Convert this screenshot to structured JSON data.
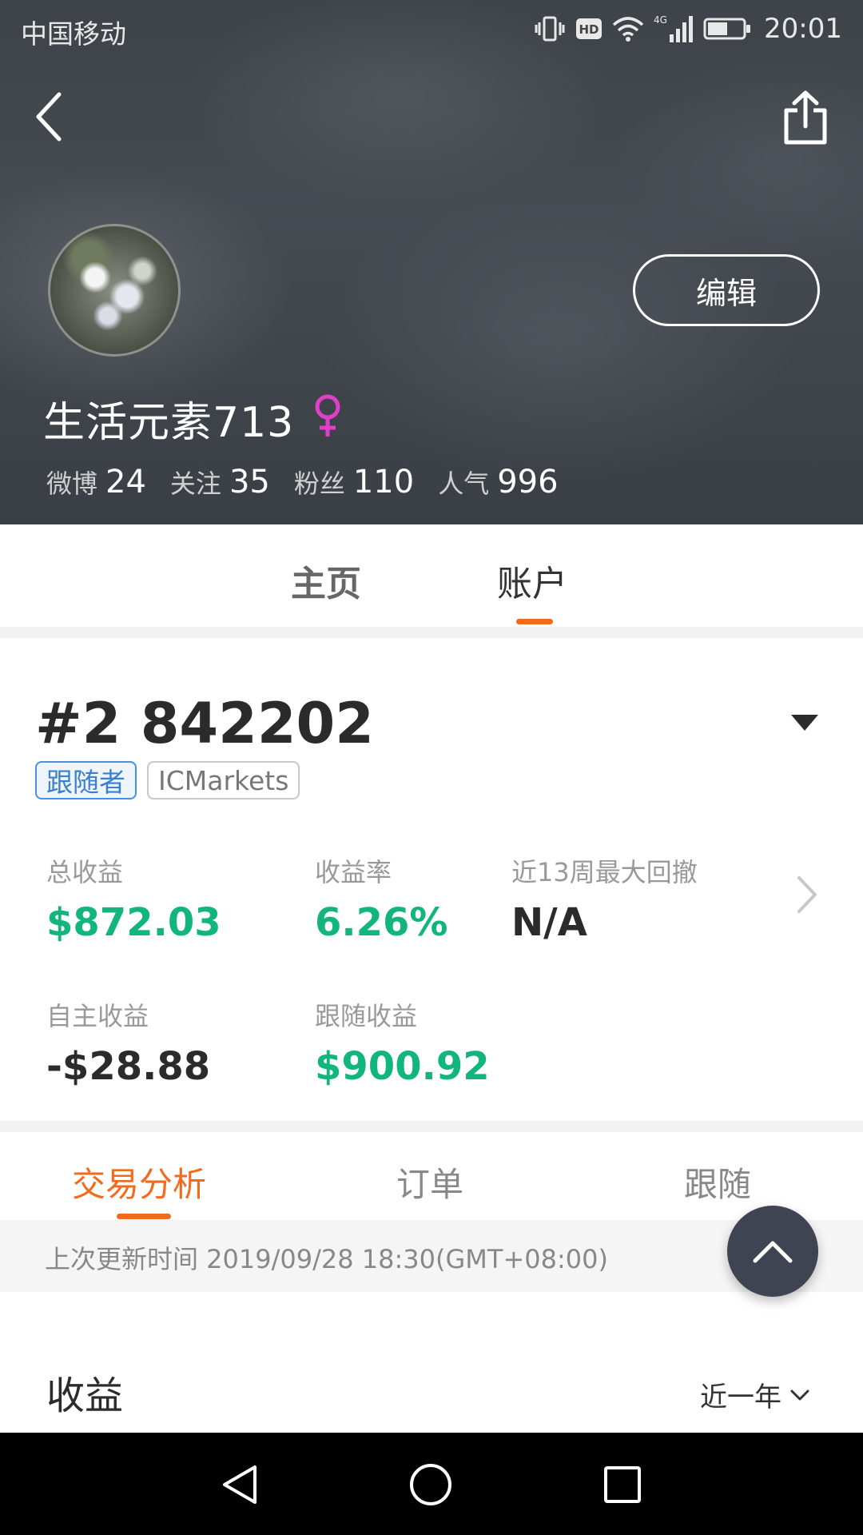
{
  "status_bar": {
    "carrier": "中国移动",
    "network_badge": "HD",
    "cellular_label": "4G",
    "time": "20:01",
    "icons": [
      "vibrate-icon",
      "hd-icon",
      "wifi-icon",
      "signal-icon",
      "battery-icon"
    ]
  },
  "profile": {
    "edit_label": "编辑",
    "username": "生活元素713",
    "gender": "female",
    "stats": [
      {
        "label": "微博",
        "value": "24"
      },
      {
        "label": "关注",
        "value": "35"
      },
      {
        "label": "粉丝",
        "value": "110"
      },
      {
        "label": "人气",
        "value": "996"
      }
    ]
  },
  "main_tabs": [
    {
      "label": "主页",
      "active": false
    },
    {
      "label": "账户",
      "active": true
    }
  ],
  "account": {
    "id": "#2 842202",
    "tags": [
      "跟随者",
      "ICMarkets"
    ],
    "metrics": {
      "total": {
        "label": "总收益",
        "value": "$872.03"
      },
      "rate": {
        "label": "收益率",
        "value": "6.26%"
      },
      "drawdown": {
        "label": "近13周最大回撤",
        "value": "N/A"
      },
      "self": {
        "label": "自主收益",
        "value": "-$28.88"
      },
      "follow": {
        "label": "跟随收益",
        "value": "$900.92"
      }
    }
  },
  "sub_tabs": [
    {
      "label": "交易分析",
      "active": true
    },
    {
      "label": "订单",
      "active": false
    },
    {
      "label": "跟随",
      "active": false
    }
  ],
  "update_text": "上次更新时间 2019/09/28 18:30(GMT+08:00)",
  "earnings": {
    "title": "收益",
    "period": "近一年"
  },
  "colors": {
    "accent": "#f26b1d",
    "positive": "#12b57d",
    "tag_blue": "#3a80d0",
    "gender_pink": "#e040c8"
  }
}
